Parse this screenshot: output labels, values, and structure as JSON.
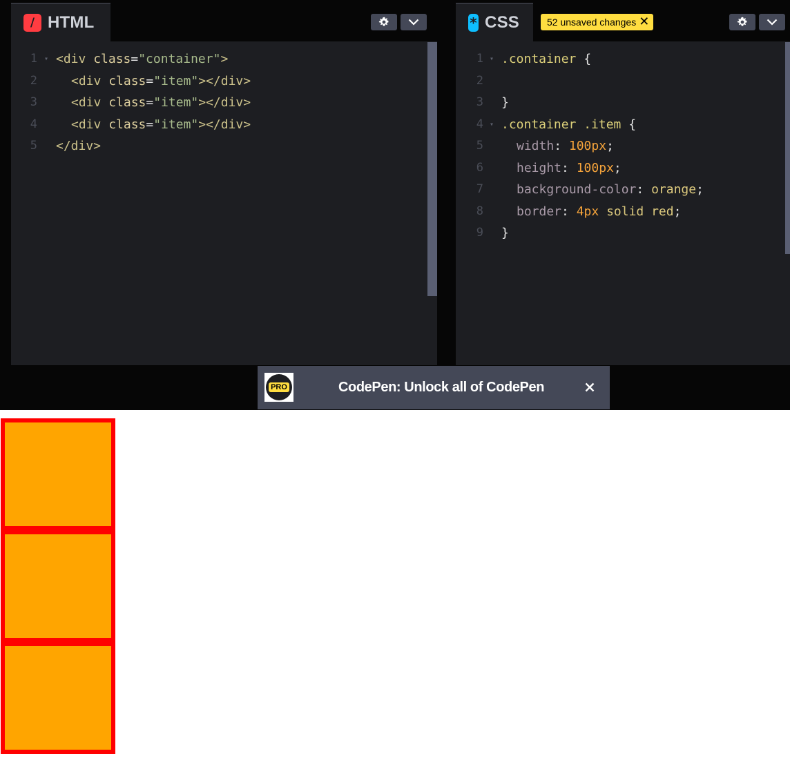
{
  "html_panel": {
    "title": "HTML",
    "icon": "html-slash-icon",
    "accent_color": "#ff3c41",
    "lines": [
      {
        "num": "1",
        "fold": true,
        "tokens": [
          {
            "t": "<div ",
            "c": "tag"
          },
          {
            "t": "class",
            "c": "attr"
          },
          {
            "t": "=",
            "c": "plain"
          },
          {
            "t": "\"container\"",
            "c": "str"
          },
          {
            "t": ">",
            "c": "tag"
          }
        ]
      },
      {
        "num": "2",
        "indent": 1,
        "tokens": [
          {
            "t": "<div ",
            "c": "tag"
          },
          {
            "t": "class",
            "c": "attr"
          },
          {
            "t": "=",
            "c": "plain"
          },
          {
            "t": "\"item\"",
            "c": "str"
          },
          {
            "t": "></div>",
            "c": "tag"
          }
        ]
      },
      {
        "num": "3",
        "indent": 1,
        "tokens": [
          {
            "t": "<div ",
            "c": "tag"
          },
          {
            "t": "class",
            "c": "attr"
          },
          {
            "t": "=",
            "c": "plain"
          },
          {
            "t": "\"item\"",
            "c": "str"
          },
          {
            "t": "></div>",
            "c": "tag"
          }
        ]
      },
      {
        "num": "4",
        "indent": 1,
        "tokens": [
          {
            "t": "<div ",
            "c": "tag"
          },
          {
            "t": "class",
            "c": "attr"
          },
          {
            "t": "=",
            "c": "plain"
          },
          {
            "t": "\"item\"",
            "c": "str"
          },
          {
            "t": "></div>",
            "c": "tag"
          }
        ]
      },
      {
        "num": "5",
        "tokens": [
          {
            "t": "</div>",
            "c": "tag"
          }
        ]
      }
    ]
  },
  "css_panel": {
    "title": "CSS",
    "icon": "css-asterisk-icon",
    "accent_color": "#0ebeff",
    "unsaved_badge": "52 unsaved changes",
    "lines": [
      {
        "num": "1",
        "fold": true,
        "tokens": [
          {
            "t": ".container ",
            "c": "sel"
          },
          {
            "t": "{",
            "c": "plain"
          }
        ]
      },
      {
        "num": "2",
        "tokens": []
      },
      {
        "num": "3",
        "tokens": [
          {
            "t": "}",
            "c": "plain"
          }
        ]
      },
      {
        "num": "4",
        "fold": true,
        "tokens": [
          {
            "t": ".container .item ",
            "c": "sel"
          },
          {
            "t": "{",
            "c": "plain"
          }
        ]
      },
      {
        "num": "5",
        "indent": 1,
        "tokens": [
          {
            "t": "width",
            "c": "prop"
          },
          {
            "t": ": ",
            "c": "plain"
          },
          {
            "t": "100px",
            "c": "num"
          },
          {
            "t": ";",
            "c": "plain"
          }
        ]
      },
      {
        "num": "6",
        "indent": 1,
        "tokens": [
          {
            "t": "height",
            "c": "prop"
          },
          {
            "t": ": ",
            "c": "plain"
          },
          {
            "t": "100px",
            "c": "num"
          },
          {
            "t": ";",
            "c": "plain"
          }
        ]
      },
      {
        "num": "7",
        "indent": 1,
        "tokens": [
          {
            "t": "background-color",
            "c": "prop"
          },
          {
            "t": ": ",
            "c": "plain"
          },
          {
            "t": "orange",
            "c": "kw"
          },
          {
            "t": ";",
            "c": "plain"
          }
        ]
      },
      {
        "num": "8",
        "indent": 1,
        "tokens": [
          {
            "t": "border",
            "c": "prop"
          },
          {
            "t": ": ",
            "c": "plain"
          },
          {
            "t": "4px",
            "c": "num"
          },
          {
            "t": " solid ",
            "c": "kw"
          },
          {
            "t": "red",
            "c": "kw"
          },
          {
            "t": ";",
            "c": "plain"
          }
        ]
      },
      {
        "num": "9",
        "tokens": [
          {
            "t": "}",
            "c": "plain"
          }
        ]
      }
    ]
  },
  "promo": {
    "badge": "PRO",
    "text": "CodePen: Unlock all of CodePen",
    "close_icon": "close-icon"
  },
  "preview": {
    "item_count": 3,
    "item_background": "#ffa500",
    "item_border": "#ff0000"
  }
}
